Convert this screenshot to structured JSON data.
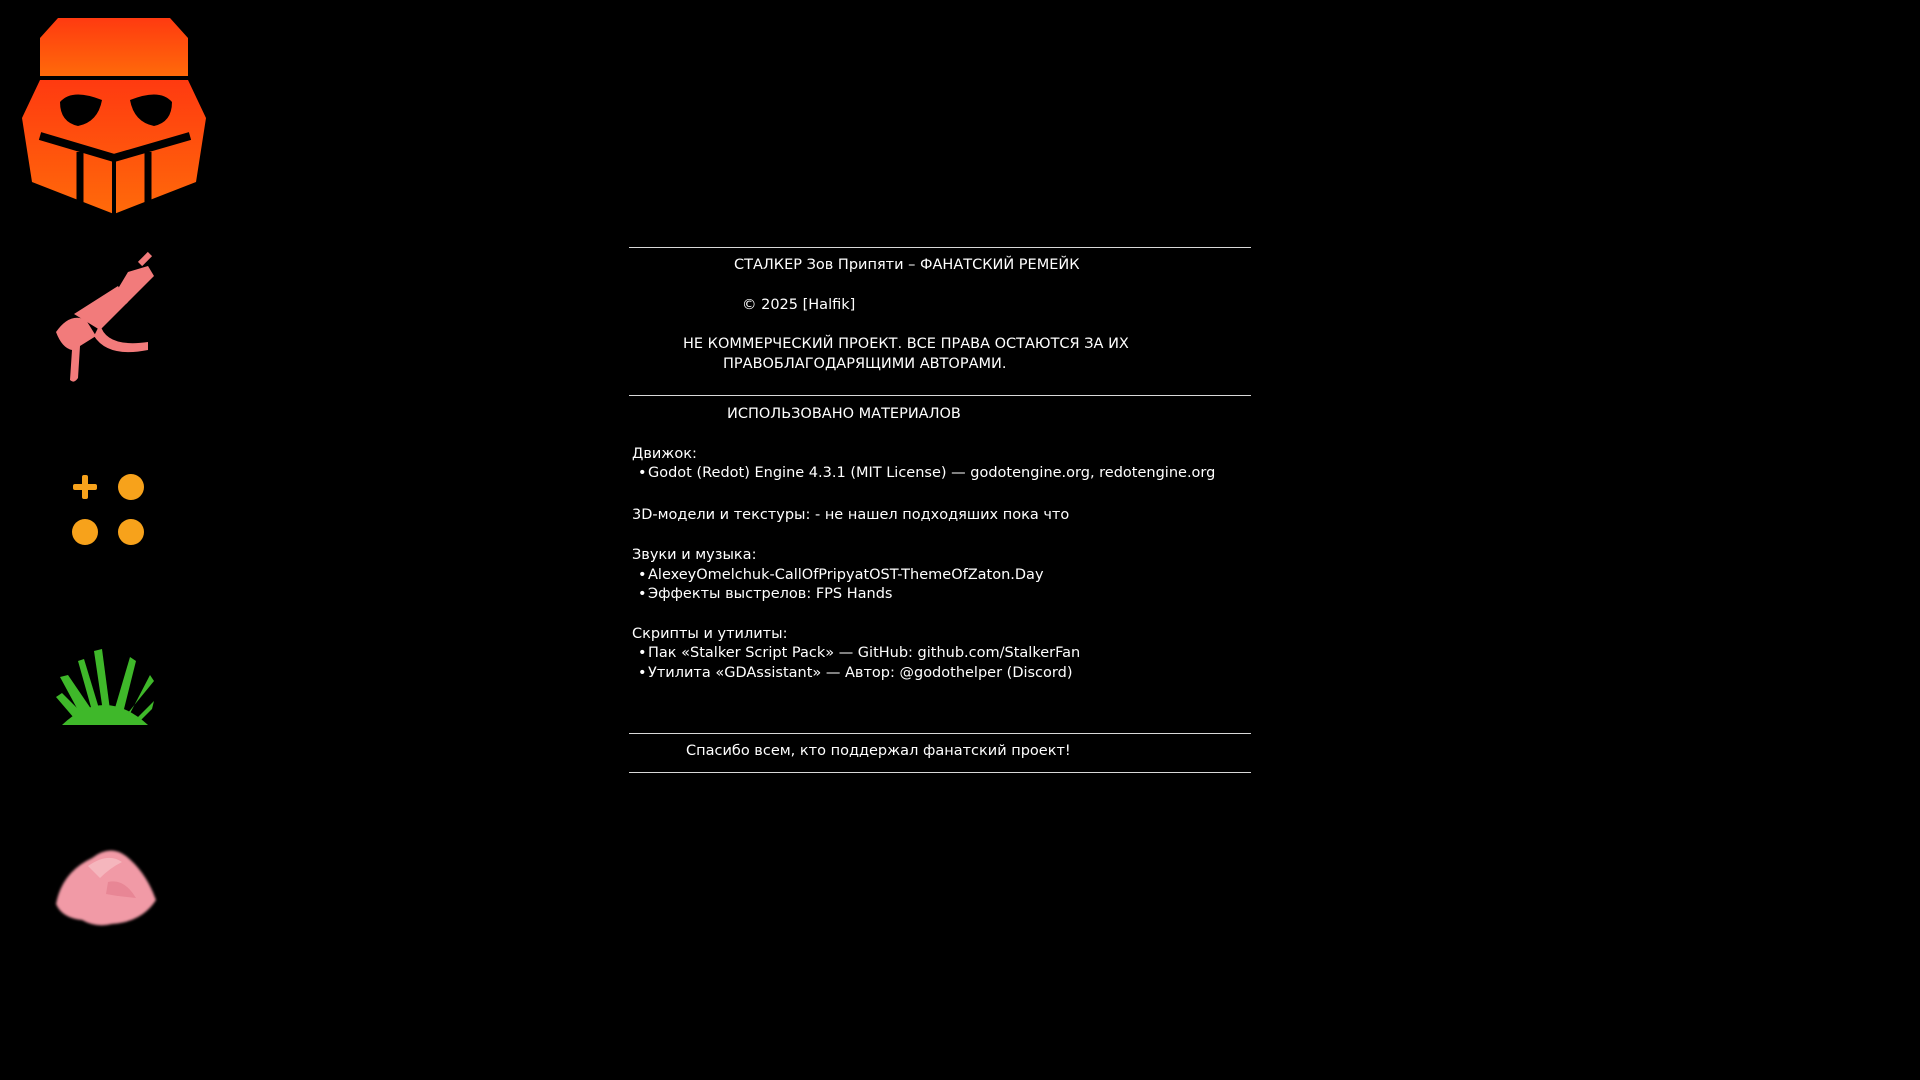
{
  "credits": {
    "title": "СТАЛКЕР Зов Припяти – ФАНАТСКИЙ РЕМЕЙК",
    "copyright": "© 2025 [Halfik]",
    "disclaimer_line1": "НЕ КОММЕРЧЕСКИЙ ПРОЕКТ. ВСЕ ПРАВА ОСТАЮТСЯ ЗА ИХ",
    "disclaimer_line2": "ПРАВОБЛАГОДАРЯЩИМИ АВТОРАМИ.",
    "materials_heading": "ИСПОЛЬЗОВАНО МАТЕРИАЛОВ",
    "engine_heading": "Движок:",
    "engine_items": [
      "Godot (Redot) Engine 4.3.1 (MIT License) — godotengine.org, redotengine.org"
    ],
    "models_line": "3D-модели и текстуры: - не нашел подходяших пока что",
    "sounds_heading": "Звуки и музыка:",
    "sounds_items": [
      "AlexeyOmelchuk-CallOfPripyatOST-ThemeOfZaton.Day",
      "Эффекты выстрелов: FPS Hands"
    ],
    "scripts_heading": "Скрипты и утилиты:",
    "scripts_items": [
      "Пак «Stalker Script Pack» — GitHub: github.com/StalkerFan",
      "Утилита «GDAssistant» — Автор: @godothelper (Discord)"
    ],
    "thanks": "Спасибо всем, кто поддержал фанатский проект!",
    "bullet_glyph": "•"
  },
  "sidebar": {
    "icons": [
      "stalker-mask-icon",
      "rifle-icon",
      "gamepad-buttons-icon",
      "grass-icon",
      "rock-icon"
    ]
  },
  "colors": {
    "background": "#000000",
    "text": "#ffffff",
    "mask_orange": "#ff4a12",
    "rifle_pink": "#f27b7b",
    "controls_orange": "#f7a21b",
    "grass_green": "#3fb82a",
    "rock_pink": "#f19aa6"
  }
}
